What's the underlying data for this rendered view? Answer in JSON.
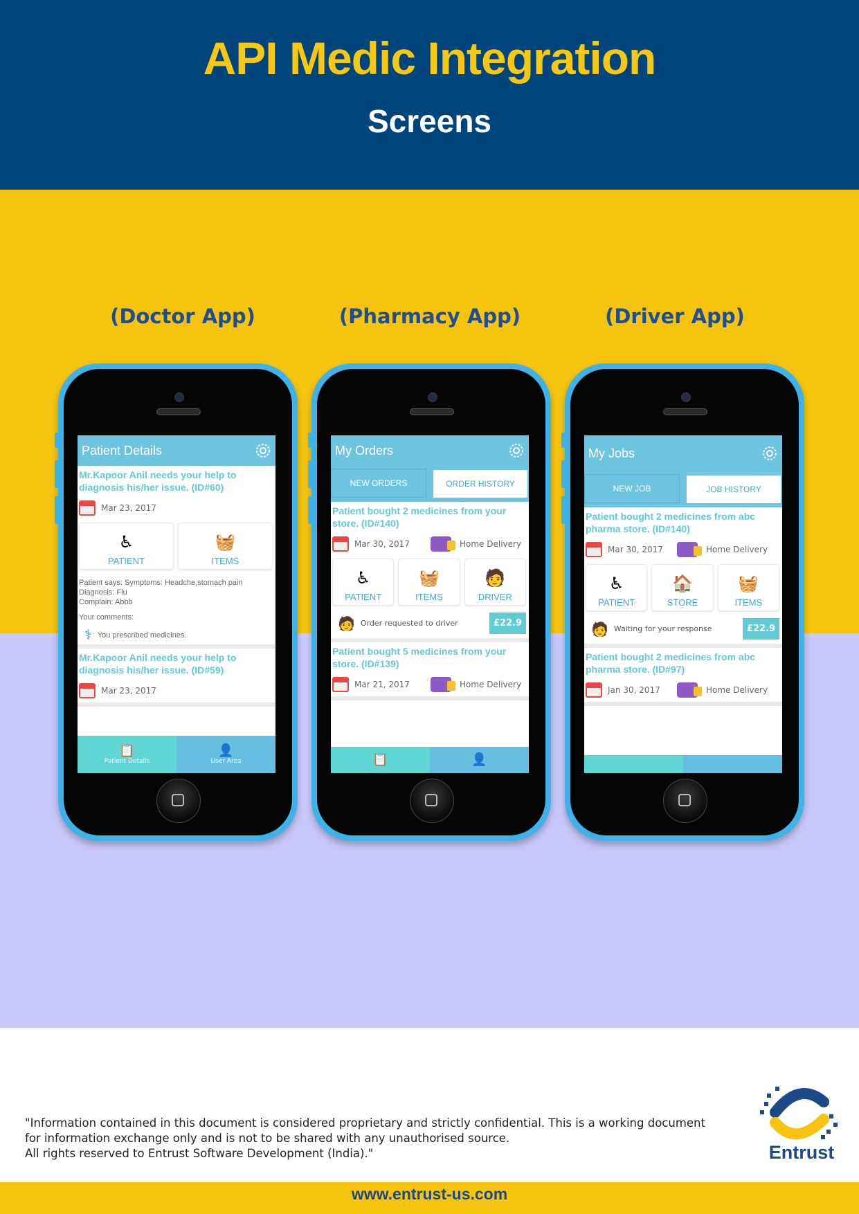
{
  "header": {
    "title": "API Medic Integration",
    "subtitle": "Screens"
  },
  "apps": [
    {
      "label": "(Doctor App)",
      "appbar_title": "Patient Details",
      "cards": [
        {
          "title": "Mr.Kapoor Anil needs your help to diagnosis his/her issue. (ID#60)",
          "date": "Mar 23, 2017",
          "tiles": [
            "PATIENT",
            "ITEMS"
          ],
          "details": [
            "Patient says: Symptoms: Headche,stomach pain",
            "Diagnosis: Flu",
            "Complain: Abbb"
          ],
          "comments_label": "Your comments:",
          "prescribed": "You prescribed medicines."
        },
        {
          "title": "Mr.Kapoor Anil needs your help to diagnosis his/her issue. (ID#59)",
          "date": "Mar 23, 2017"
        }
      ],
      "nav": [
        "Patient Details",
        "User Area"
      ]
    },
    {
      "label": "(Pharmacy App)",
      "appbar_title": "My Orders",
      "tabs": [
        "NEW ORDERS",
        "ORDER HISTORY"
      ],
      "cards": [
        {
          "title": "Patient bought 2 medicines from your store. (ID#140)",
          "date": "Mar 30, 2017",
          "delivery": "Home Delivery",
          "tiles": [
            "PATIENT",
            "ITEMS",
            "DRIVER"
          ],
          "status": "Order requested to driver",
          "price": "£22.9"
        },
        {
          "title": "Patient bought 5 medicines from your store. (ID#139)",
          "date": "Mar 21, 2017",
          "delivery": "Home Delivery"
        }
      ]
    },
    {
      "label": "(Driver App)",
      "appbar_title": "My Jobs",
      "tabs": [
        "NEW JOB",
        "JOB HISTORY"
      ],
      "cards": [
        {
          "title": "Patient bought 2 medicines from abc pharma store. (ID#140)",
          "date": "Mar 30, 2017",
          "delivery": "Home Delivery",
          "tiles": [
            "PATIENT",
            "STORE",
            "ITEMS"
          ],
          "status": "Waiting for your response",
          "price": "£22.9"
        },
        {
          "title": "Patient bought 2 medicines from abc pharma store. (ID#97)",
          "date": "Jan 30, 2017",
          "delivery": "Home Delivery"
        }
      ]
    }
  ],
  "disclaimer": {
    "line1": "\"Information contained in this document is considered proprietary and strictly confidential. This is a working document",
    "line2": "for information exchange only and is not to be shared with any unauthorised source.",
    "line3": "All rights reserved to Entrust Software Development (India).\""
  },
  "logo": {
    "text": "Entrust"
  },
  "footer": {
    "url": "www.entrust-us.com"
  },
  "colors": {
    "navy": "#00457c",
    "yellow": "#f6c40f",
    "lavender": "#c9c8fa",
    "teal": "#5fcbd2",
    "appbar": "#6cc4e1"
  }
}
